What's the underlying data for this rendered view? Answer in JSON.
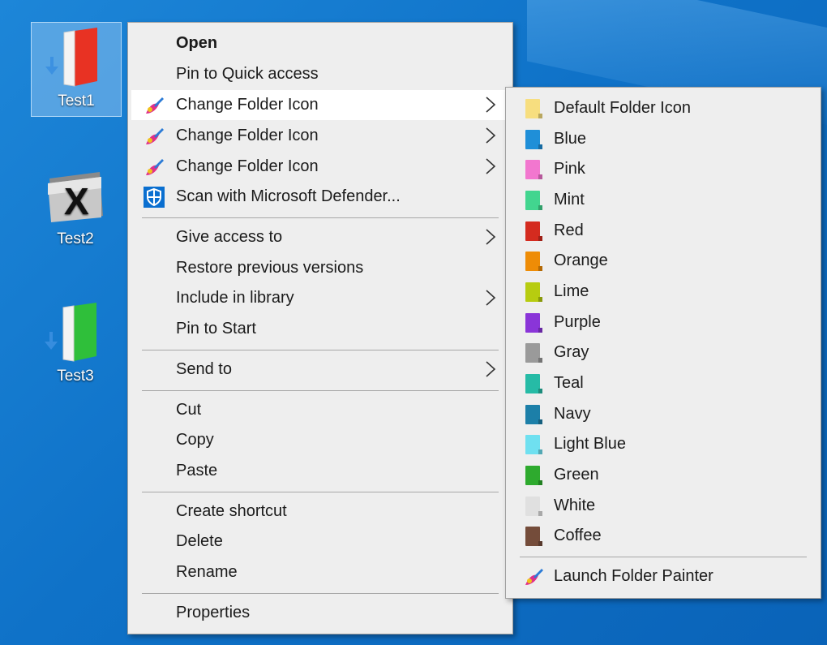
{
  "desktop": {
    "icons": [
      {
        "label": "Test1",
        "color": "#e83223",
        "selected": true
      },
      {
        "label": "Test2",
        "color": "#3c3c3c",
        "selected": false
      },
      {
        "label": "Test3",
        "color": "#2fbf3a",
        "selected": false
      }
    ]
  },
  "context_menu": {
    "items": [
      {
        "label": "Open",
        "bold": true
      },
      {
        "label": "Pin to Quick access"
      },
      {
        "label": "Change Folder Icon",
        "icon": "folder-painter-icon",
        "submenu": true,
        "highlighted": true
      },
      {
        "label": "Change Folder Icon",
        "icon": "folder-painter-icon",
        "submenu": true
      },
      {
        "label": "Change Folder Icon",
        "icon": "folder-painter-icon",
        "submenu": true
      },
      {
        "label": "Scan with Microsoft Defender...",
        "icon": "defender-shield-icon"
      },
      {
        "label": "Give access to",
        "submenu": true
      },
      {
        "label": "Restore previous versions"
      },
      {
        "label": "Include in library",
        "submenu": true
      },
      {
        "label": "Pin to Start"
      },
      {
        "label": "Send to",
        "submenu": true
      },
      {
        "label": "Cut"
      },
      {
        "label": "Copy"
      },
      {
        "label": "Paste"
      },
      {
        "label": "Create shortcut"
      },
      {
        "label": "Delete"
      },
      {
        "label": "Rename"
      },
      {
        "label": "Properties"
      }
    ]
  },
  "submenu": {
    "items": [
      {
        "label": "Default Folder Icon",
        "color": "#f7de7f"
      },
      {
        "label": "Blue",
        "color": "#1f8fd8"
      },
      {
        "label": "Pink",
        "color": "#f277cf"
      },
      {
        "label": "Mint",
        "color": "#42d58f"
      },
      {
        "label": "Red",
        "color": "#d42b1f"
      },
      {
        "label": "Orange",
        "color": "#ee8c06"
      },
      {
        "label": "Lime",
        "color": "#b7cc10"
      },
      {
        "label": "Purple",
        "color": "#8a35d8"
      },
      {
        "label": "Gray",
        "color": "#9a9a9a"
      },
      {
        "label": "Teal",
        "color": "#26bba6"
      },
      {
        "label": "Navy",
        "color": "#1c7fa8"
      },
      {
        "label": "Light Blue",
        "color": "#6fe0f0"
      },
      {
        "label": "Green",
        "color": "#2eaa2e"
      },
      {
        "label": "White",
        "color": "#e0e0e0"
      },
      {
        "label": "Coffee",
        "color": "#744c3a"
      }
    ],
    "launch_label": "Launch Folder Painter"
  }
}
